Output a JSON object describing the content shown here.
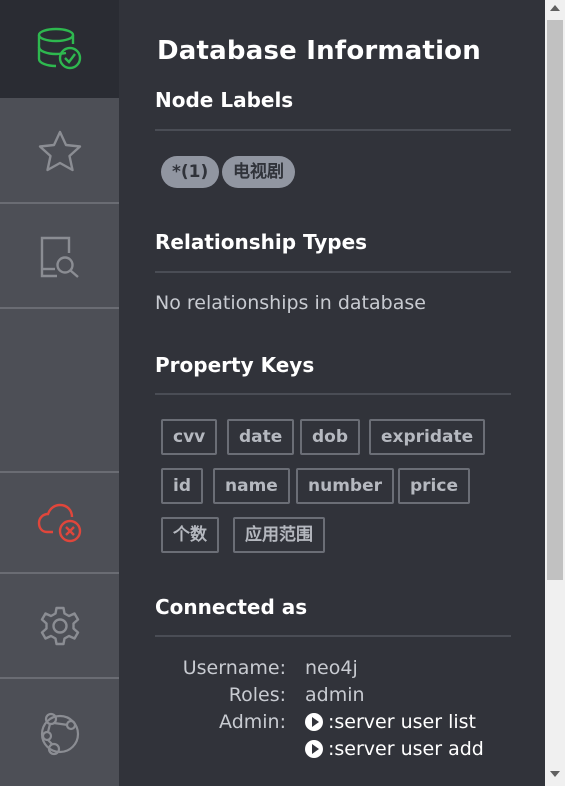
{
  "sidebar": {
    "items": [
      {
        "name": "database-check-icon",
        "color": "#2eb84f"
      },
      {
        "name": "star-icon",
        "color": "#8b8d93"
      },
      {
        "name": "document-search-icon",
        "color": "#8b8d93"
      },
      {
        "name": "cloud-disconnected-icon",
        "color": "#e0463b"
      },
      {
        "name": "gear-icon",
        "color": "#8b8d93"
      },
      {
        "name": "neo4j-browser-icon",
        "color": "#8b8d93"
      }
    ]
  },
  "drawer": {
    "title": "Database Information",
    "node_labels": {
      "heading": "Node Labels",
      "labels": [
        "*(1)",
        "电视剧"
      ]
    },
    "relationship_types": {
      "heading": "Relationship Types",
      "empty_text": "No relationships in database"
    },
    "property_keys": {
      "heading": "Property Keys",
      "keys": [
        "cvv",
        "date",
        "dob",
        "expridate",
        "id",
        "name",
        "number",
        "price",
        "个数",
        "应用范围"
      ]
    },
    "connected_as": {
      "heading": "Connected as",
      "username_label": "Username:",
      "username": "neo4j",
      "roles_label": "Roles:",
      "roles": "admin",
      "admin_label": "Admin:",
      "commands": [
        ":server user list",
        ":server user add"
      ]
    }
  },
  "colors": {
    "sidebar_bg": "#4d4f56",
    "drawer_bg": "#31333a",
    "active_green": "#2eb84f",
    "disconnected_red": "#e0463b"
  }
}
